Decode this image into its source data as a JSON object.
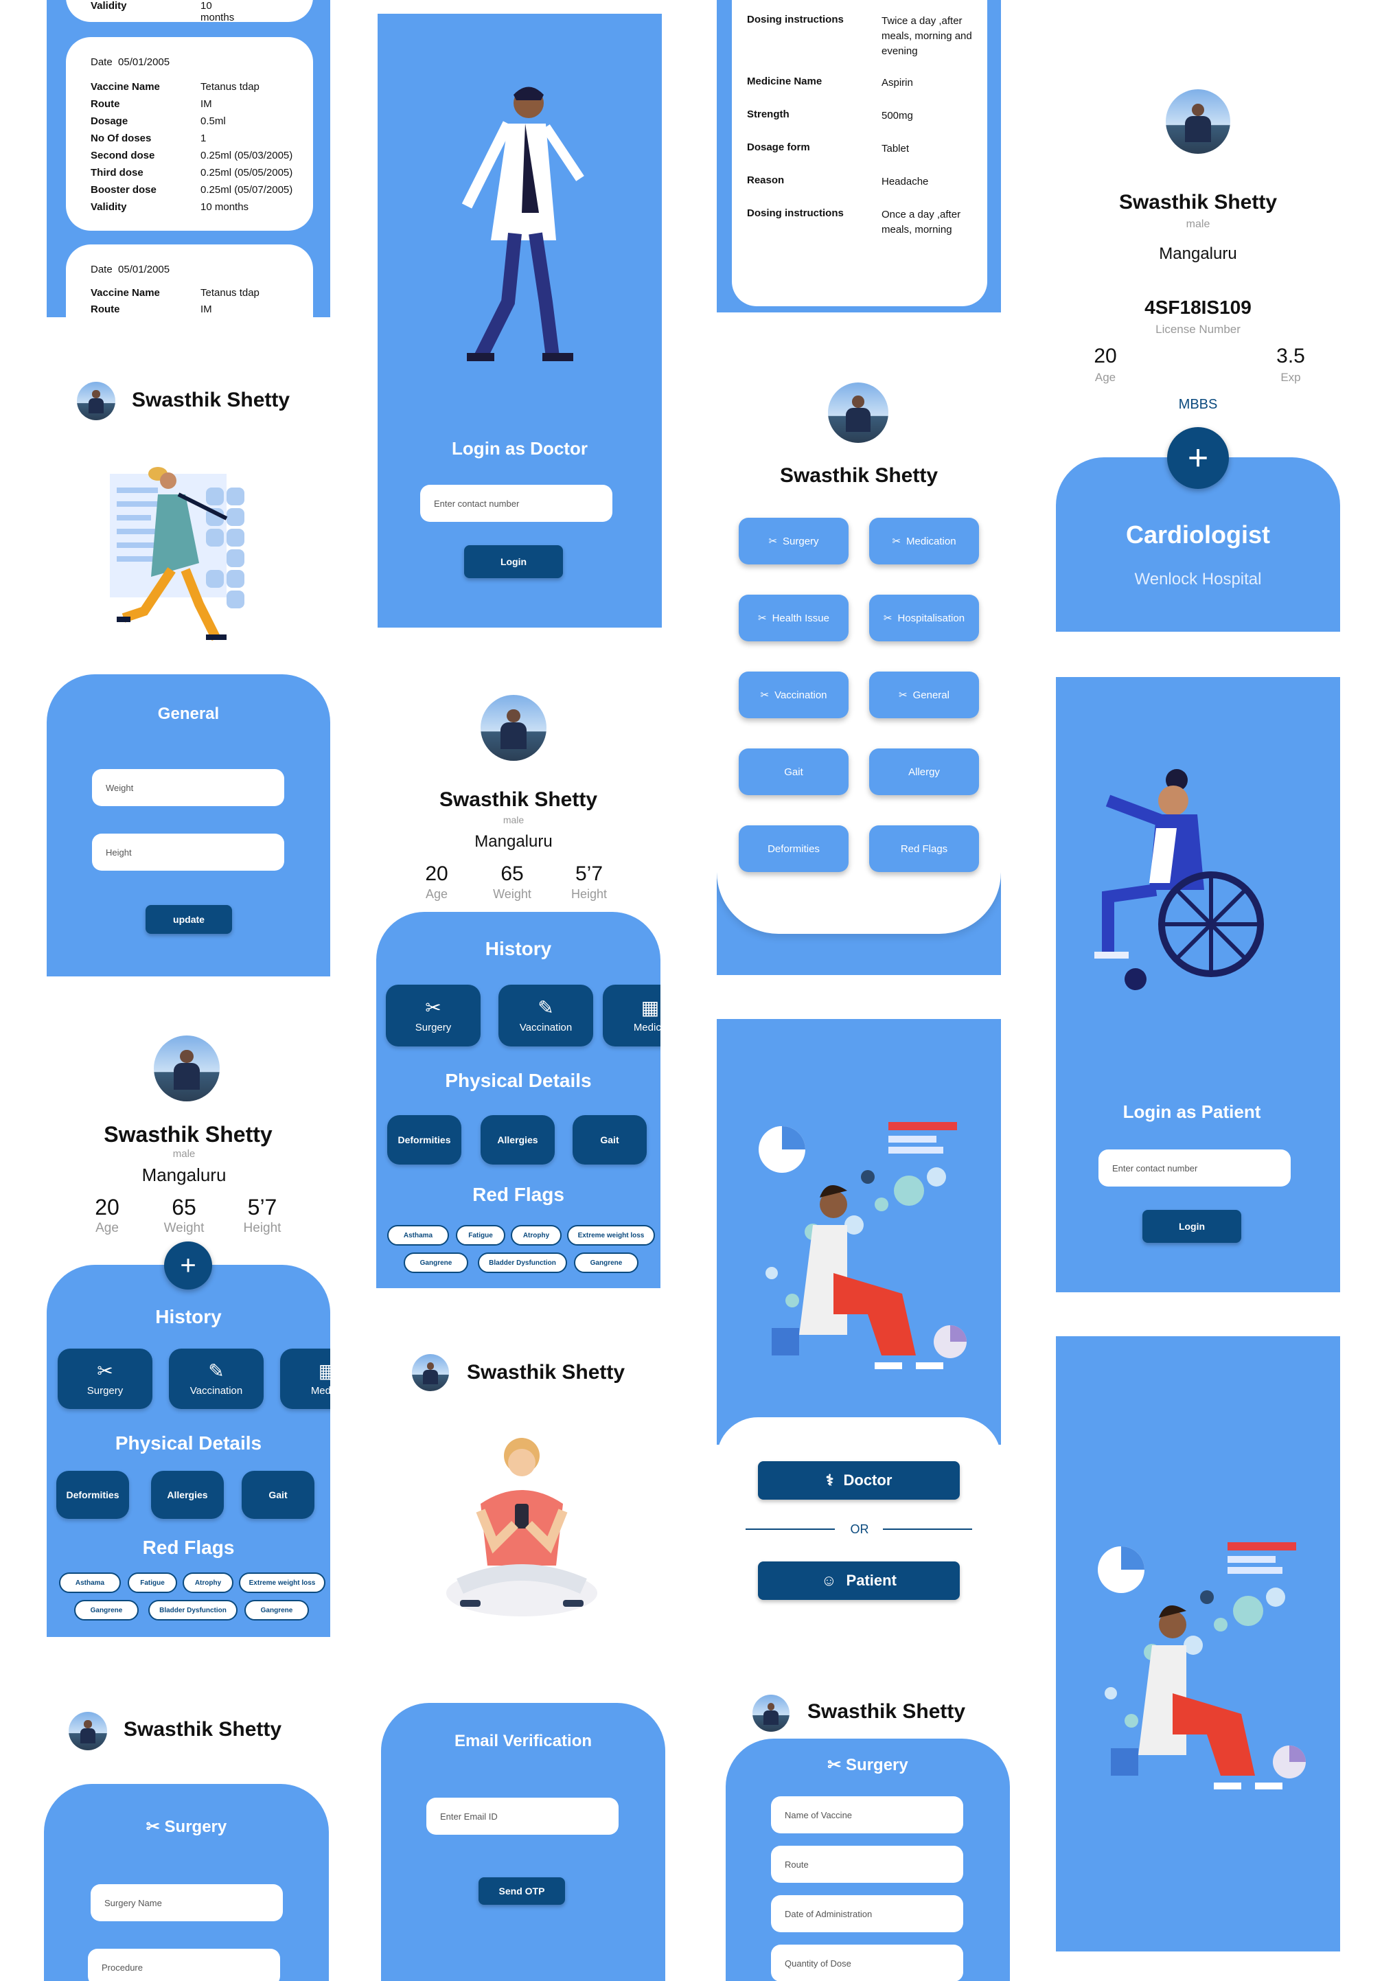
{
  "user": {
    "name": "Swasthik Shetty",
    "gender": "male",
    "city": "Mangaluru"
  },
  "stats": {
    "age": "20",
    "age_label": "Age",
    "weight": "65",
    "weight_label": "Weight",
    "height": "5’7",
    "height_label": "Height"
  },
  "vaccine_records": {
    "prev_validity_key": "Validity",
    "prev_validity_val": "10 months",
    "record": {
      "date_label": "Date",
      "date": "05/01/2005",
      "rows": [
        {
          "k": "Vaccine Name",
          "v": "Tetanus tdap"
        },
        {
          "k": "Route",
          "v": "IM"
        },
        {
          "k": "Dosage",
          "v": "0.5ml"
        },
        {
          "k": "No Of doses",
          "v": "1"
        },
        {
          "k": "Second dose",
          "v": "0.25ml (05/03/2005)"
        },
        {
          "k": "Third dose",
          "v": "0.25ml (05/05/2005)"
        },
        {
          "k": "Booster dose",
          "v": "0.25ml (05/07/2005)"
        },
        {
          "k": "Validity",
          "v": "10 months"
        }
      ]
    },
    "next": {
      "date_label": "Date",
      "date": "05/01/2005",
      "rows": [
        {
          "k": "Vaccine Name",
          "v": "Tetanus tdap"
        },
        {
          "k": "Route",
          "v": "IM"
        }
      ]
    }
  },
  "login_doctor": {
    "title": "Login as Doctor",
    "placeholder": "Enter contact number",
    "button": "Login"
  },
  "login_patient": {
    "title": "Login as Patient",
    "placeholder": "Enter contact number",
    "button": "Login"
  },
  "medication": {
    "rows": [
      {
        "k": "Dosing instructions",
        "v1": "Twice a day ,after",
        "v2": "meals, morning and",
        "v3": "evening"
      },
      {
        "k": "Medicine Name",
        "v1": "Aspirin"
      },
      {
        "k": "Strength",
        "v1": "500mg"
      },
      {
        "k": "Dosage form",
        "v1": "Tablet"
      },
      {
        "k": "Reason",
        "v1": "Headache"
      },
      {
        "k": "Dosing instructions",
        "v1": "Once a day ,after",
        "v2": "meals, morning"
      }
    ]
  },
  "doctor_profile": {
    "license": "4SF18IS109",
    "license_label": "License Number",
    "age": "20",
    "age_label": "Age",
    "exp": "3.5",
    "exp_label": "Exp",
    "degree": "MBBS",
    "specialty": "Cardiologist",
    "hospital": "Wenlock Hospital",
    "add": "+"
  },
  "general_form": {
    "title": "General",
    "weight_ph": "Weight",
    "height_ph": "Height",
    "button": "update"
  },
  "categories": [
    "Surgery",
    "Medication",
    "Health Issue",
    "Hospitalisation",
    "Vaccination",
    "General",
    "Gait",
    "Allergy",
    "Deformities",
    "Red Flags"
  ],
  "history": {
    "title": "History",
    "tiles": [
      "Surgery",
      "Vaccination",
      "Medica"
    ],
    "physical_title": "Physical Details",
    "physical": [
      "Deformities",
      "Allergies",
      "Gait"
    ],
    "red_title": "Red Flags",
    "flags_row1": [
      "Asthama",
      "Fatigue",
      "Atrophy",
      "Extreme weight loss"
    ],
    "flags_row2": [
      "Gangrene",
      "Bladder Dysfunction",
      "Gangrene"
    ],
    "add": "+"
  },
  "role_select": {
    "doctor": "Doctor",
    "or": "OR",
    "patient": "Patient"
  },
  "surgery_form": {
    "title": "Surgery",
    "name_ph": "Surgery Name",
    "proc_ph": "Procedure"
  },
  "email_verify": {
    "title": "Email Verification",
    "placeholder": "Enter Email ID",
    "button": "Send OTP"
  },
  "vaccine_form": {
    "title": "Surgery",
    "fields": [
      "Name of Vaccine",
      "Route",
      "Date of Administration",
      "Quantity of Dose"
    ]
  },
  "colors": {
    "panel": "#5b9ff0",
    "navy": "#0b4a7e"
  }
}
